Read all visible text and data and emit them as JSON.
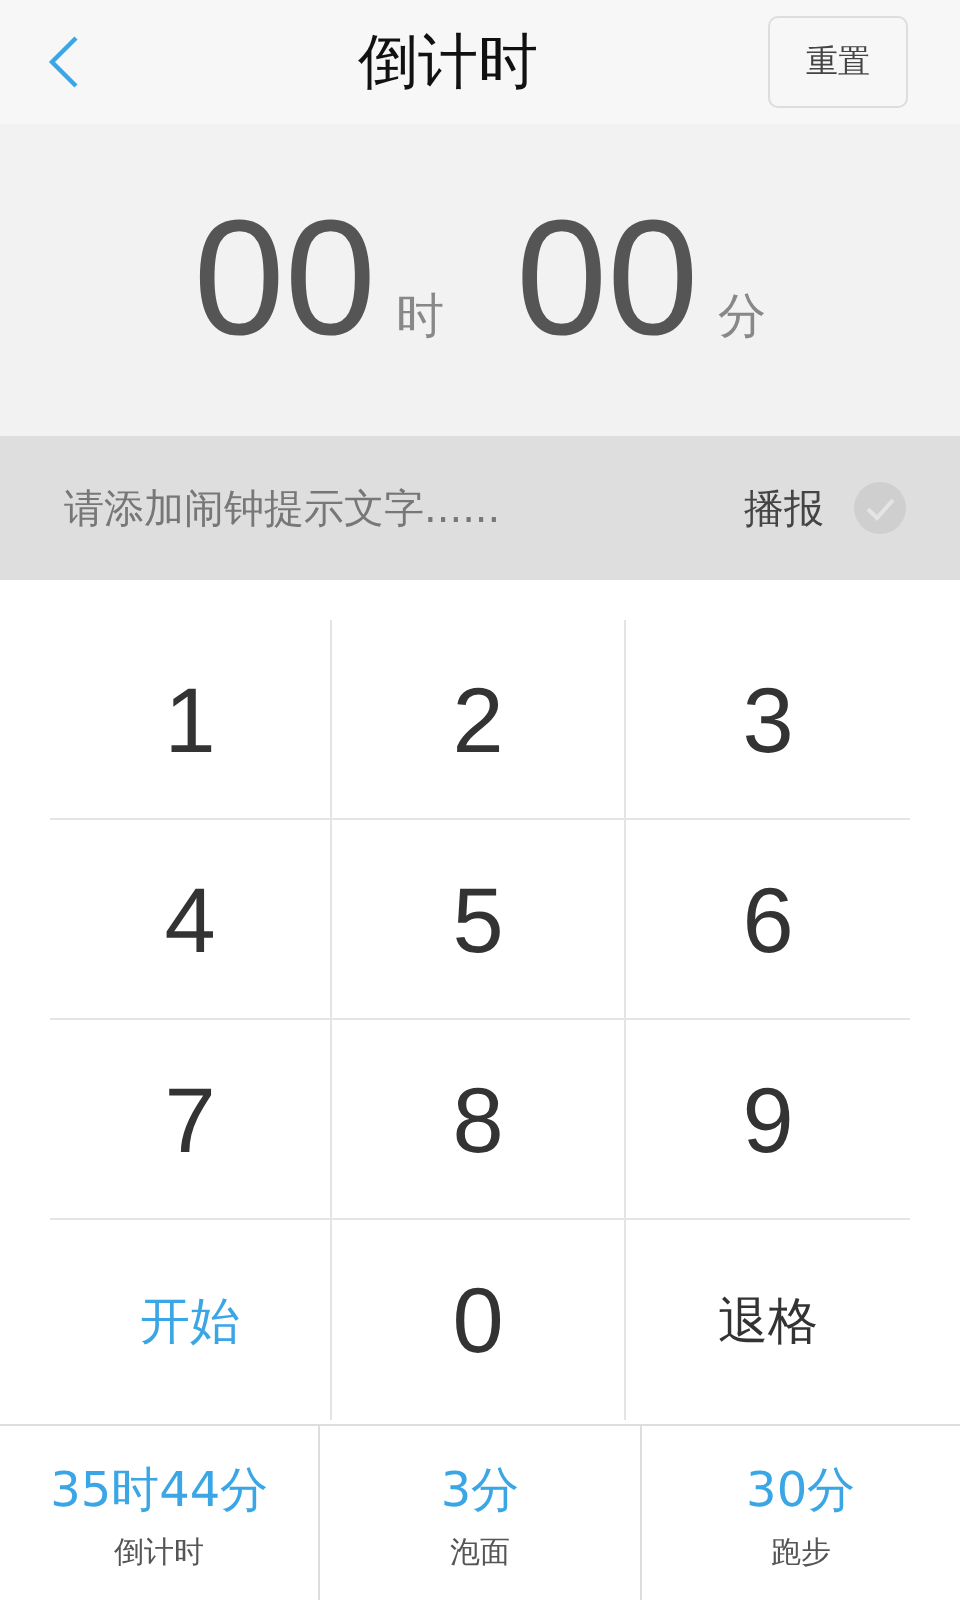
{
  "header": {
    "title": "倒计时",
    "reset_button": "重置"
  },
  "display": {
    "hours": "00",
    "hours_unit": "时",
    "minutes": "00",
    "minutes_unit": "分"
  },
  "reminder": {
    "placeholder": "请添加闹钟提示文字......",
    "announce_label": "播报",
    "announce_checked": false
  },
  "keypad": [
    {
      "label": "1",
      "kind": "digit"
    },
    {
      "label": "2",
      "kind": "digit"
    },
    {
      "label": "3",
      "kind": "digit"
    },
    {
      "label": "4",
      "kind": "digit"
    },
    {
      "label": "5",
      "kind": "digit"
    },
    {
      "label": "6",
      "kind": "digit"
    },
    {
      "label": "7",
      "kind": "digit"
    },
    {
      "label": "8",
      "kind": "digit"
    },
    {
      "label": "9",
      "kind": "digit"
    },
    {
      "label": "开始",
      "kind": "start"
    },
    {
      "label": "0",
      "kind": "digit"
    },
    {
      "label": "退格",
      "kind": "backspace"
    }
  ],
  "presets": [
    {
      "time": "35时44分",
      "name": "倒计时"
    },
    {
      "time": "3分",
      "name": "泡面"
    },
    {
      "time": "30分",
      "name": "跑步"
    }
  ]
}
